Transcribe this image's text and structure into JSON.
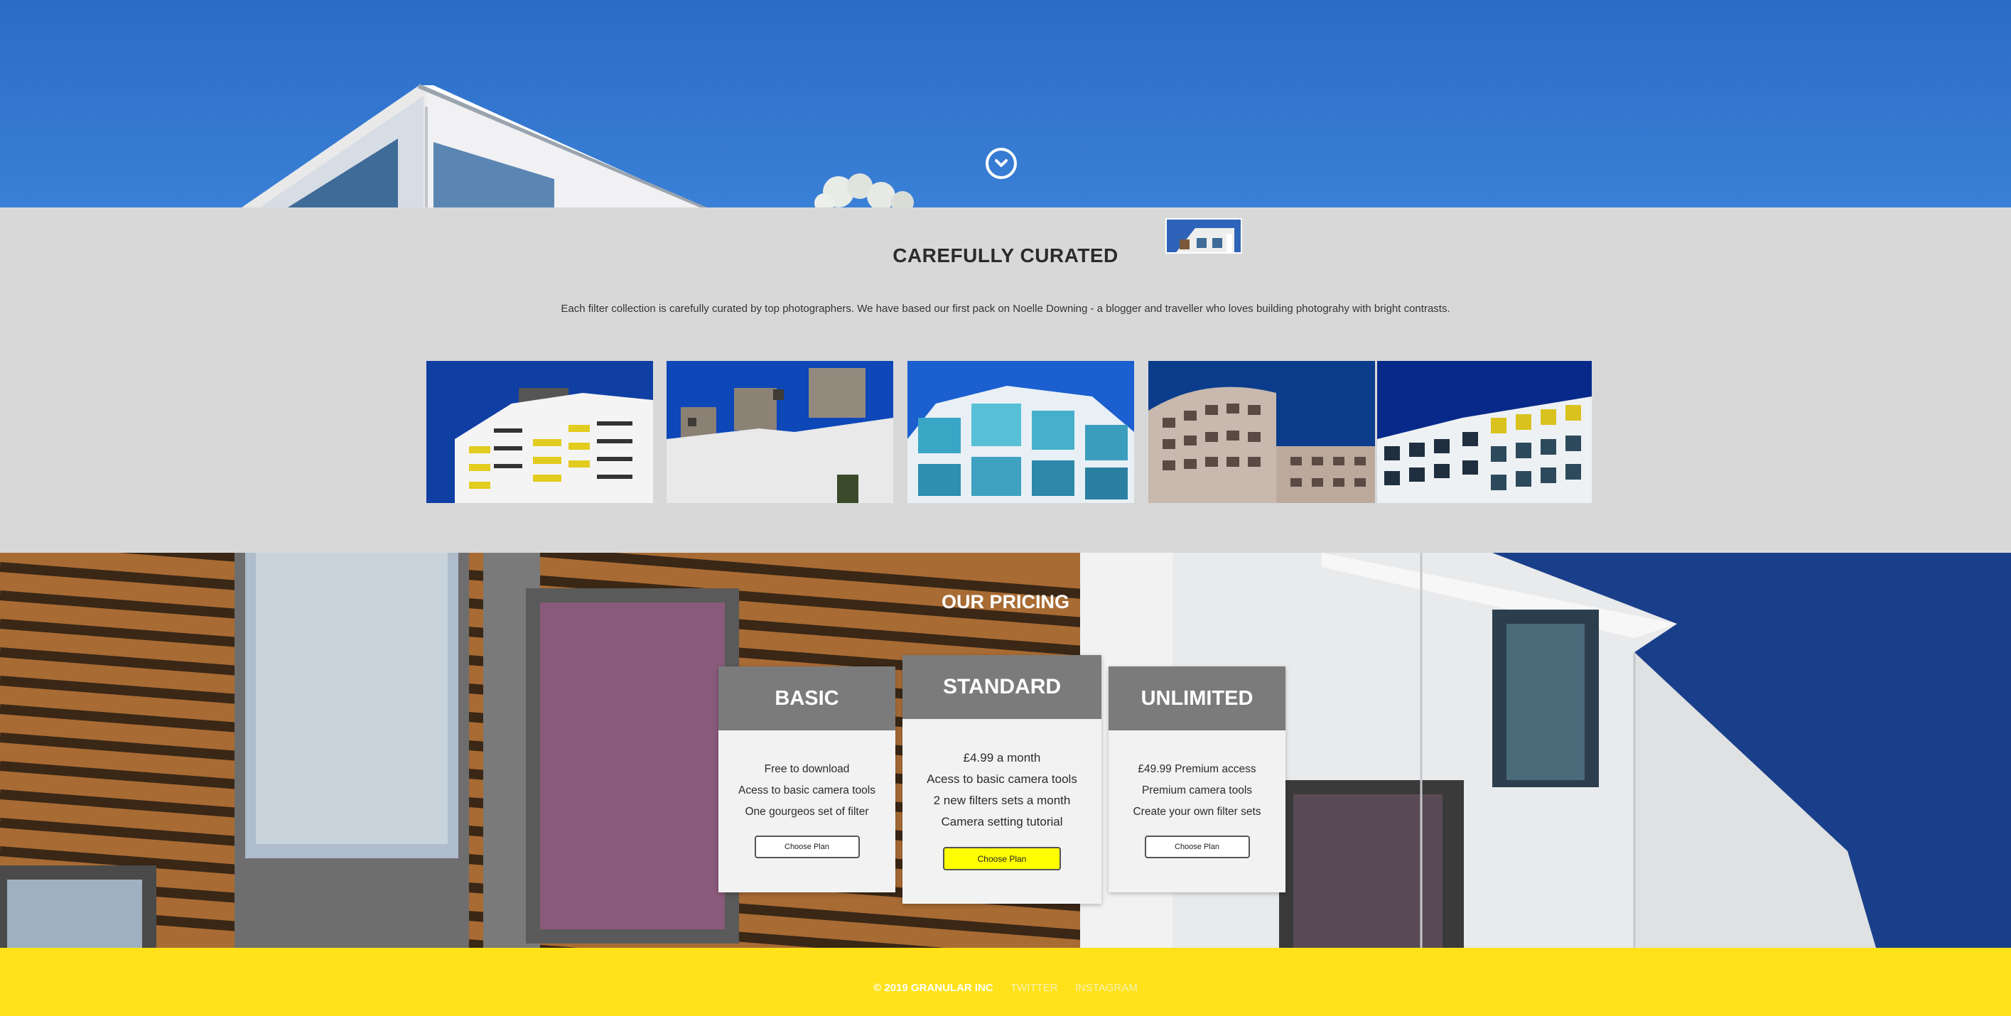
{
  "hero": {
    "scroll_icon": "chevron-down-circle-icon"
  },
  "curated": {
    "title": "CAREFULLY CURATED",
    "description": "Each filter collection is carefully curated by top photographers. We have based our first pack on Noelle Downing - a blogger and traveller who loves building photograhy with bright contrasts.",
    "photos": [
      {
        "subject": "tower-yellow-balconies"
      },
      {
        "subject": "white-concrete-blocks"
      },
      {
        "subject": "glass-blue-apartments"
      },
      {
        "subject": "curved-brick-building"
      },
      {
        "subject": "yellow-window-facade"
      }
    ]
  },
  "pricing": {
    "title": "OUR PRICING",
    "plans": [
      {
        "name": "BASIC",
        "features": [
          "Free to download",
          "Acess to basic camera tools",
          "One gourgeos set of filter"
        ],
        "button": "Choose Plan"
      },
      {
        "name": "STANDARD",
        "features": [
          "£4.99 a month",
          "Acess to basic camera tools",
          "2 new filters sets a month",
          "Camera setting tutorial"
        ],
        "button": "Choose Plan",
        "highlight_color": "#ffff00"
      },
      {
        "name": "UNLIMITED",
        "features": [
          "£49.99 Premium access",
          "Premium camera tools",
          "Create your own filter sets"
        ],
        "button": "Choose Plan"
      }
    ]
  },
  "footer": {
    "copyright": "© 2019 GRANULAR INC",
    "links": [
      "TWITTER",
      "INSTAGRAM"
    ],
    "background": "#ffe21a"
  },
  "colors": {
    "sky": "#3a80d6",
    "section_gray": "#d8d8d8",
    "plan_header": "#7b7b7b",
    "accent_yellow": "#ffff00"
  }
}
